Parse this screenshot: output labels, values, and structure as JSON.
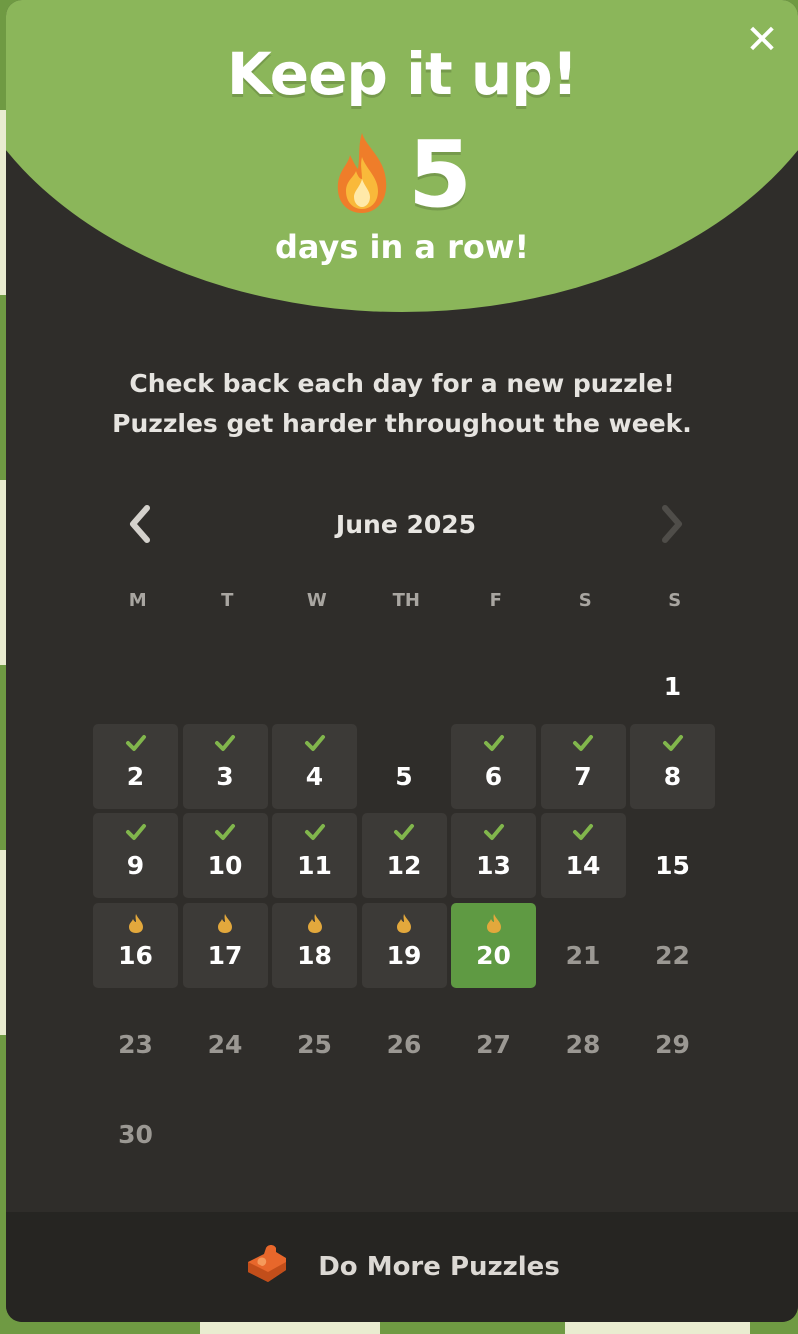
{
  "modal": {
    "close_label": "✕",
    "title": "Keep it up!",
    "streak_count": "5",
    "streak_label": "days in a row!",
    "intro_line1": "Check back each day for a new puzzle!",
    "intro_line2": "Puzzles get harder throughout the week."
  },
  "calendar": {
    "month_label": "June 2025",
    "prev_icon": "chevron-left-icon",
    "next_icon": "chevron-right-icon",
    "weekdays": [
      "M",
      "T",
      "W",
      "TH",
      "F",
      "S",
      "S"
    ],
    "days": [
      {
        "day": "1",
        "status": "plain"
      },
      {
        "day": "2",
        "status": "solved"
      },
      {
        "day": "3",
        "status": "solved"
      },
      {
        "day": "4",
        "status": "solved"
      },
      {
        "day": "5",
        "status": "plain"
      },
      {
        "day": "6",
        "status": "solved"
      },
      {
        "day": "7",
        "status": "solved"
      },
      {
        "day": "8",
        "status": "solved"
      },
      {
        "day": "9",
        "status": "solved"
      },
      {
        "day": "10",
        "status": "solved"
      },
      {
        "day": "11",
        "status": "solved"
      },
      {
        "day": "12",
        "status": "solved"
      },
      {
        "day": "13",
        "status": "solved"
      },
      {
        "day": "14",
        "status": "solved"
      },
      {
        "day": "15",
        "status": "plain"
      },
      {
        "day": "16",
        "status": "streak"
      },
      {
        "day": "17",
        "status": "streak"
      },
      {
        "day": "18",
        "status": "streak"
      },
      {
        "day": "19",
        "status": "streak"
      },
      {
        "day": "20",
        "status": "today"
      },
      {
        "day": "21",
        "status": "future"
      },
      {
        "day": "22",
        "status": "future"
      },
      {
        "day": "23",
        "status": "future"
      },
      {
        "day": "24",
        "status": "future"
      },
      {
        "day": "25",
        "status": "future"
      },
      {
        "day": "26",
        "status": "future"
      },
      {
        "day": "27",
        "status": "future"
      },
      {
        "day": "28",
        "status": "future"
      },
      {
        "day": "29",
        "status": "future"
      },
      {
        "day": "30",
        "status": "future"
      }
    ]
  },
  "footer": {
    "label": "Do More Puzzles",
    "icon": "puzzle-piece-icon"
  },
  "colors": {
    "hero_green": "#8bb65a",
    "today_green": "#5f9a43",
    "check_green": "#81b64c",
    "flame_gold": "#e3a83c",
    "panel": "#2f2d2a"
  }
}
